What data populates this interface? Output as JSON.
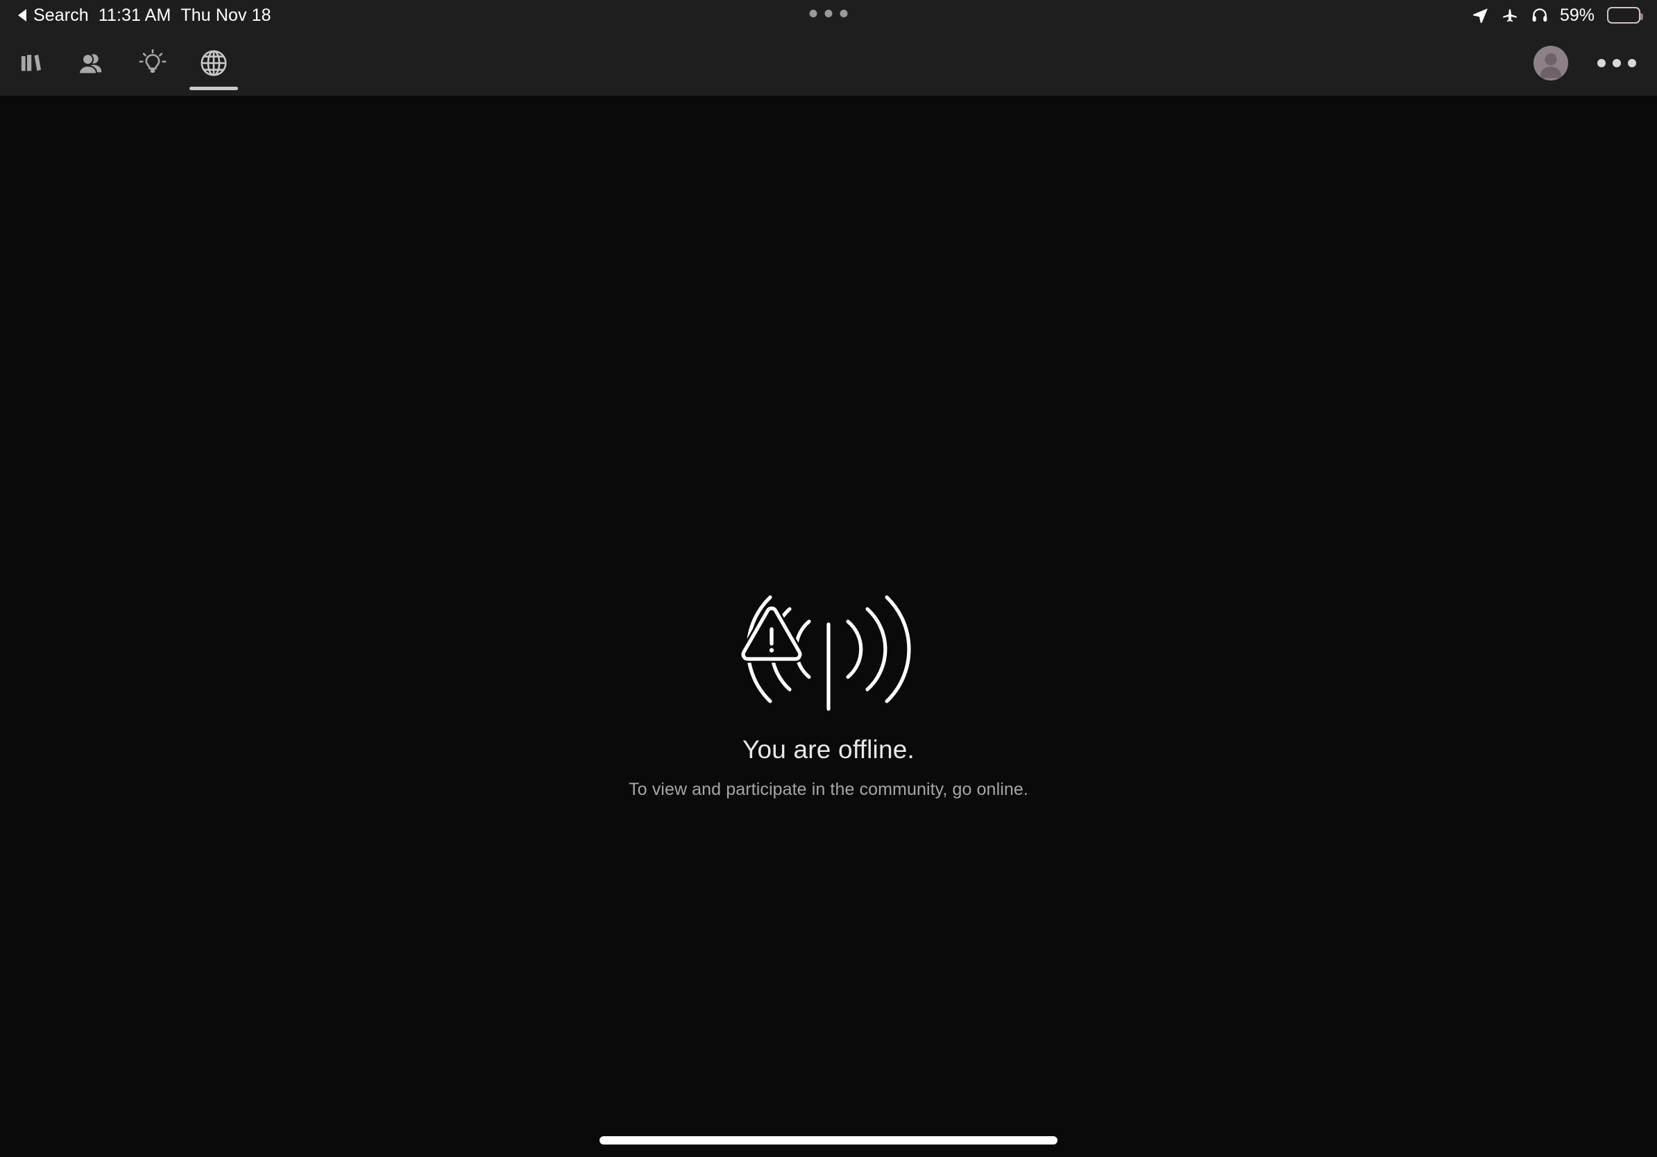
{
  "status_bar": {
    "back_label": "Search",
    "time": "11:31 AM",
    "date": "Thu Nov 18",
    "battery_percent": "59%",
    "battery_level": 59,
    "icons": [
      "location-arrow-icon",
      "airplane-mode-icon",
      "headphones-icon",
      "battery-icon"
    ],
    "multitask_dots": "•••"
  },
  "toolbar": {
    "tabs": [
      {
        "id": "library",
        "icon": "books-icon",
        "label": "Library",
        "active": false
      },
      {
        "id": "people",
        "icon": "people-icon",
        "label": "People",
        "active": false
      },
      {
        "id": "ideas",
        "icon": "lightbulb-icon",
        "label": "Ideas",
        "active": false
      },
      {
        "id": "community",
        "icon": "globe-icon",
        "label": "Community",
        "active": true
      }
    ],
    "account": {
      "icon": "avatar-icon",
      "label": "Account"
    },
    "more": {
      "icon": "more-dots-icon",
      "label": "More options"
    }
  },
  "main": {
    "empty_state": {
      "illustration": "offline-broadcast-warning-icon",
      "title": "You are offline.",
      "subtitle": "To view and participate in the community, go online."
    }
  },
  "system": {
    "home_indicator": "home-indicator"
  },
  "colors": {
    "toolbar_bg": "#1e1e1e",
    "content_bg": "#0a0a0a",
    "icon": "#a8a8a8",
    "icon_active": "#c9c9c9",
    "title_text": "#e9e9e9",
    "subtitle_text": "#a8a5a5",
    "avatar_bg": "#8e8089"
  }
}
